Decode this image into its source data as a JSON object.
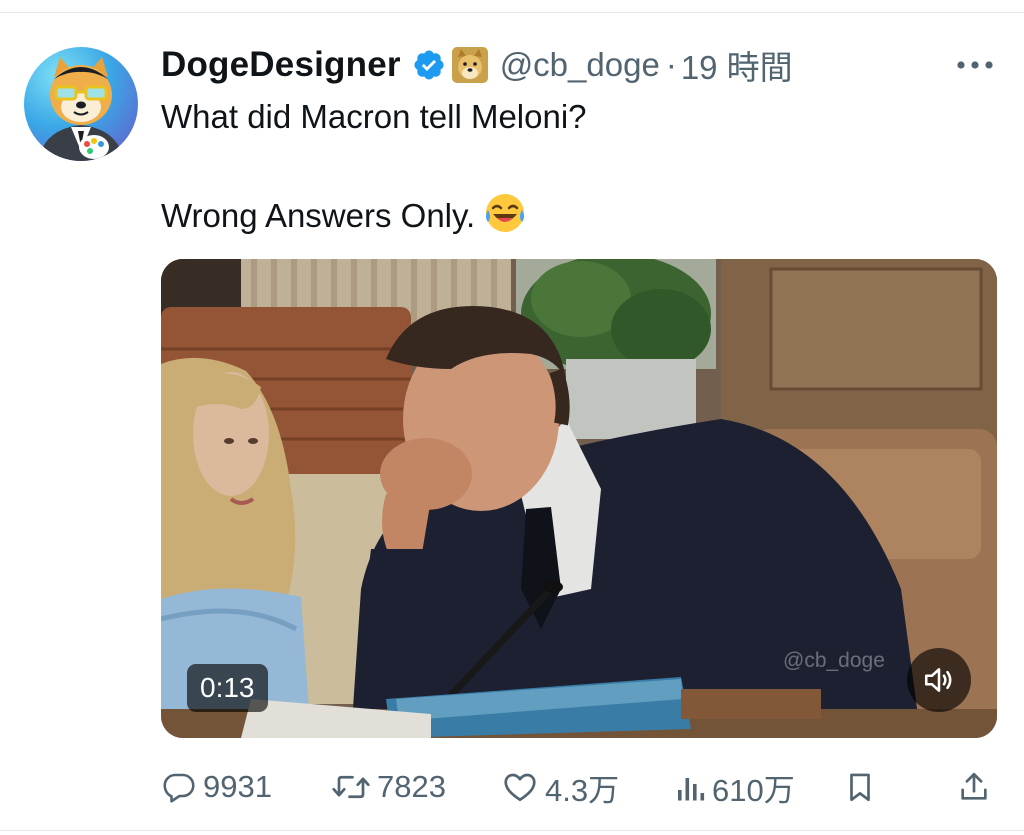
{
  "author": {
    "display_name": "DogeDesigner",
    "handle": "@cb_doge",
    "separator": "·",
    "time": "19 時間",
    "verified_color": "#1d9bf0"
  },
  "tweet": {
    "line1": "What did Macron tell Meloni?",
    "line2": "Wrong Answers Only."
  },
  "media": {
    "duration": "0:13",
    "watermark": "@cb_doge"
  },
  "actions": {
    "replies": "9931",
    "reposts": "7823",
    "likes": "4.3万",
    "views": "610万"
  },
  "icons": [
    "verified-badge-icon",
    "doge-emoji-icon",
    "more-icon",
    "laughing-emoji-icon",
    "speaker-icon",
    "reply-icon",
    "repost-icon",
    "like-icon",
    "views-icon",
    "bookmark-icon",
    "share-icon"
  ],
  "colors": {
    "text": "#0f1419",
    "secondary": "#536471",
    "accent": "#1d9bf0"
  }
}
